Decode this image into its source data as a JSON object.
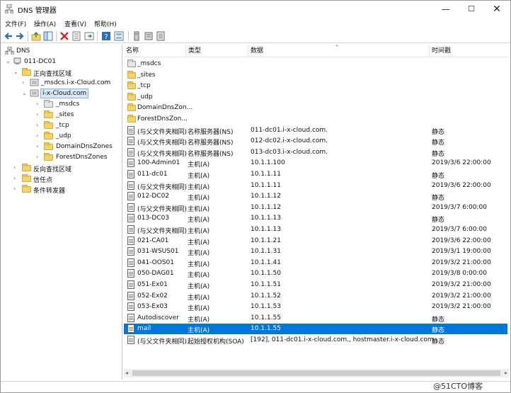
{
  "window": {
    "title": "DNS 管理器",
    "controls": {
      "minimize": "—",
      "maximize": "☐",
      "close": "✕"
    }
  },
  "menu": [
    "文件(F)",
    "操作(A)",
    "查看(V)",
    "帮助(H)"
  ],
  "toolbar": {
    "buttons": [
      "back-arrow-icon",
      "forward-arrow-icon",
      "up-folder-icon",
      "show-tree-icon",
      "delete-icon",
      "properties-icon",
      "refresh-icon",
      "export-icon",
      "help-icon",
      "view-icon",
      "server-icon",
      "server-alt-icon",
      "zone-icon"
    ]
  },
  "tree": [
    {
      "label": "DNS",
      "icon": "dns-icon",
      "expanded": true
    },
    {
      "label": "011-DC01",
      "icon": "server-icon",
      "expanded": true
    },
    {
      "label": "正向查找区域",
      "icon": "folder-icon",
      "expanded": true
    },
    {
      "label": "_msdcs.i-x-Cloud.com",
      "icon": "zone-icon",
      "expanded": false
    },
    {
      "label": "i-x-Cloud.com",
      "icon": "zone-icon",
      "expanded": true,
      "selected": true
    },
    {
      "label": "_msdcs",
      "icon": "grey-folder-icon",
      "expanded": false
    },
    {
      "label": "_sites",
      "icon": "folder-icon",
      "expanded": false
    },
    {
      "label": "_tcp",
      "icon": "folder-icon",
      "expanded": false
    },
    {
      "label": "_udp",
      "icon": "folder-icon",
      "expanded": false
    },
    {
      "label": "DomainDnsZones",
      "icon": "folder-icon",
      "expanded": false
    },
    {
      "label": "ForestDnsZones",
      "icon": "folder-icon",
      "expanded": false
    },
    {
      "label": "反向查找区域",
      "icon": "folder-icon",
      "expanded": false
    },
    {
      "label": "信任点",
      "icon": "folder-icon",
      "expanded": false
    },
    {
      "label": "条件转发器",
      "icon": "folder-icon",
      "expanded": false
    }
  ],
  "columns": [
    "名称",
    "类型",
    "数据",
    "时间戳"
  ],
  "records": [
    {
      "name": "_msdcs",
      "type": "",
      "data": "",
      "timestamp": "",
      "icon": "grey-folder-icon"
    },
    {
      "name": "_sites",
      "type": "",
      "data": "",
      "timestamp": "",
      "icon": "folder-icon"
    },
    {
      "name": "_tcp",
      "type": "",
      "data": "",
      "timestamp": "",
      "icon": "folder-icon"
    },
    {
      "name": "_udp",
      "type": "",
      "data": "",
      "timestamp": "",
      "icon": "folder-icon"
    },
    {
      "name": "DomainDnsZon...",
      "type": "",
      "data": "",
      "timestamp": "",
      "icon": "folder-icon"
    },
    {
      "name": "ForestDnsZon...",
      "type": "",
      "data": "",
      "timestamp": "",
      "icon": "folder-icon"
    },
    {
      "name": "(与父文件夹相同)",
      "type": "名称服务器(NS)",
      "data": "011-dc01.i-x-cloud.com.",
      "timestamp": "静态",
      "icon": "record-icon"
    },
    {
      "name": "(与父文件夹相同)",
      "type": "名称服务器(NS)",
      "data": "012-dc02.i-x-cloud.com.",
      "timestamp": "静态",
      "icon": "record-icon"
    },
    {
      "name": "(与父文件夹相同)",
      "type": "名称服务器(NS)",
      "data": "013-dc03.i-x-cloud.com.",
      "timestamp": "静态",
      "icon": "record-icon"
    },
    {
      "name": "100-Admin01",
      "type": "主机(A)",
      "data": "10.1.1.100",
      "timestamp": "2019/3/6 22:00:00",
      "icon": "record-icon"
    },
    {
      "name": "011-dc01",
      "type": "主机(A)",
      "data": "10.1.1.11",
      "timestamp": "静态",
      "icon": "record-icon"
    },
    {
      "name": "(与父文件夹相同)",
      "type": "主机(A)",
      "data": "10.1.1.11",
      "timestamp": "2019/3/6 22:00:00",
      "icon": "record-icon"
    },
    {
      "name": "012-DC02",
      "type": "主机(A)",
      "data": "10.1.1.12",
      "timestamp": "静态",
      "icon": "record-icon"
    },
    {
      "name": "(与父文件夹相同)",
      "type": "主机(A)",
      "data": "10.1.1.12",
      "timestamp": "2019/3/7 6:00:00",
      "icon": "record-icon"
    },
    {
      "name": "013-DC03",
      "type": "主机(A)",
      "data": "10.1.1.13",
      "timestamp": "静态",
      "icon": "record-icon"
    },
    {
      "name": "(与父文件夹相同)",
      "type": "主机(A)",
      "data": "10.1.1.13",
      "timestamp": "2019/3/7 6:00:00",
      "icon": "record-icon"
    },
    {
      "name": "021-CA01",
      "type": "主机(A)",
      "data": "10.1.1.21",
      "timestamp": "2019/3/6 22:00:00",
      "icon": "record-icon"
    },
    {
      "name": "031-WSUS01",
      "type": "主机(A)",
      "data": "10.1.1.31",
      "timestamp": "2019/3/1 19:00:00",
      "icon": "record-icon"
    },
    {
      "name": "041-OOS01",
      "type": "主机(A)",
      "data": "10.1.1.41",
      "timestamp": "2019/3/2 21:00:00",
      "icon": "record-icon"
    },
    {
      "name": "050-DAG01",
      "type": "主机(A)",
      "data": "10.1.1.50",
      "timestamp": "2019/3/8 0:00:00",
      "icon": "record-icon"
    },
    {
      "name": "051-Ex01",
      "type": "主机(A)",
      "data": "10.1.1.51",
      "timestamp": "2019/3/2 21:00:00",
      "icon": "record-icon"
    },
    {
      "name": "052-Ex02",
      "type": "主机(A)",
      "data": "10.1.1.52",
      "timestamp": "2019/3/2 21:00:00",
      "icon": "record-icon"
    },
    {
      "name": "053-Ex03",
      "type": "主机(A)",
      "data": "10.1.1.53",
      "timestamp": "2019/3/2 21:00:00",
      "icon": "record-icon"
    },
    {
      "name": "Autodiscover",
      "type": "主机(A)",
      "data": "10.1.1.55",
      "timestamp": "静态",
      "icon": "record-icon"
    },
    {
      "name": "mail",
      "type": "主机(A)",
      "data": "10.1.1.55",
      "timestamp": "静态",
      "icon": "record-icon",
      "selected": true
    },
    {
      "name": "(与父文件夹相同)",
      "type": "起始授权机构(SOA)",
      "data": "[192], 011-dc01.i-x-cloud.com., hostmaster.i-x-cloud.com.",
      "timestamp": "静态",
      "icon": "record-icon"
    }
  ],
  "watermark": "@51CTO博客",
  "colors": {
    "selection": "#0078d7",
    "tree_selection": "#d9e8f7",
    "folder": "#f3d36b"
  }
}
